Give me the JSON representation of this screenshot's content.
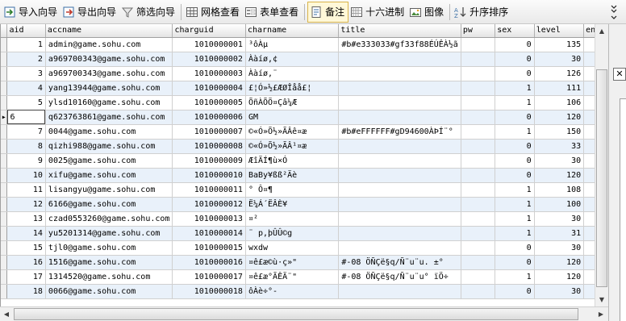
{
  "toolbar": {
    "import_wizard": "导入向导",
    "export_wizard": "导出向导",
    "filter_wizard": "筛选向导",
    "grid_view": "网格查看",
    "form_view": "表单查看",
    "memo": "备注",
    "hex": "十六进制",
    "image": "图像",
    "sort_asc": "升序排序",
    "more": "»"
  },
  "grid": {
    "columns": [
      "aid",
      "accname",
      "charguid",
      "charname",
      "title",
      "pw",
      "sex",
      "level",
      "ene"
    ],
    "rows": [
      [
        "1",
        "admin@game.sohu.com",
        "1010000001",
        "³ôÀµ",
        "#b#e333033#gf33f88ÉÚÊÀ½ã",
        "",
        "0",
        "135"
      ],
      [
        "2",
        "a969700343@game.sohu.com",
        "1010000002",
        "Ààíø,¢",
        "",
        "",
        "0",
        "30"
      ],
      [
        "3",
        "a969700343@game.sohu.com",
        "1010000003",
        "Ààíø,¨",
        "",
        "",
        "0",
        "126"
      ],
      [
        "4",
        "yang13944@game.sohu.com",
        "1010000004",
        "£¦Ó»½£ÆØÎåå£¦",
        "",
        "",
        "1",
        "111"
      ],
      [
        "5",
        "ylsd10160@game.sohu.com",
        "1010000005",
        "ÕñÀÕÖ¤Çâ¼Æ",
        "",
        "",
        "1",
        "106"
      ],
      [
        "6",
        "q623763861@game.sohu.com",
        "1010000006",
        "GM",
        "",
        "",
        "0",
        "120"
      ],
      [
        "7",
        "0044@game.sohu.com",
        "1010000007",
        "©«Ó»Õ½»ÃÂê¤æ",
        "#b#eFFFFFF#gD94600ÀÞÍ¨°",
        "",
        "1",
        "150"
      ],
      [
        "8",
        "qizhi988@game.sohu.com",
        "1010000008",
        "©«Ó»Õ½»ÃÂ¹¤æ",
        "",
        "",
        "0",
        "33"
      ],
      [
        "9",
        "0025@game.sohu.com",
        "1010000009",
        "ÆîÄÍ¶ù×Ó",
        "",
        "",
        "0",
        "30"
      ],
      [
        "10",
        "xifu@game.sohu.com",
        "1010000010",
        "BaBy¥ßß²Äè",
        "",
        "",
        "0",
        "120"
      ],
      [
        "11",
        "lisangyu@game.sohu.com",
        "1010000011",
        "° Ô¤¶",
        "",
        "",
        "1",
        "108"
      ],
      [
        "12",
        "6166@game.sohu.com",
        "1010000012",
        "Ë¼Á´ËÂÈ¥",
        "",
        "",
        "1",
        "100"
      ],
      [
        "13",
        "czad0553260@game.sohu.com",
        "1010000013",
        "¤²",
        "",
        "",
        "1",
        "30"
      ],
      [
        "14",
        "yu5201314@game.sohu.com",
        "1010000014",
        "¨ p,þÛÛ©g",
        "",
        "",
        "1",
        "31"
      ],
      [
        "15",
        "tjl0@game.sohu.com",
        "1010000015",
        "wxdw",
        "",
        "",
        "0",
        "30"
      ],
      [
        "16",
        "1516@game.sohu.com",
        "1010000016",
        "¤ê£æ©ù·ç»\"",
        "#-08 ÖÑÇë§q/Ñ¨u¨u. ±°",
        "",
        "0",
        "120"
      ],
      [
        "17",
        "1314520@game.sohu.com",
        "1010000017",
        "¤ê£æ°ÃÊÄ¨\"",
        "#-08 ÖÑÇë§q/Ñ¨u¨u° ïÖ÷",
        "",
        "1",
        "120"
      ],
      [
        "18",
        "0066@game.sohu.com",
        "1010000018",
        "ôÀè÷°-",
        "",
        "",
        "0",
        "30"
      ]
    ]
  }
}
